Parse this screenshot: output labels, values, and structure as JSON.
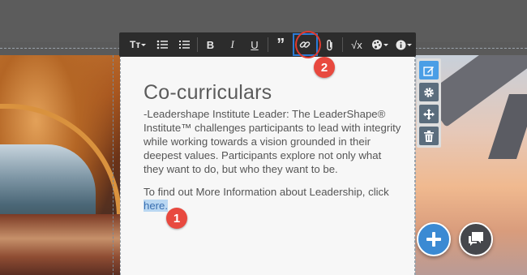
{
  "toolbar": {
    "items": [
      {
        "name": "text-style",
        "label": "Tт"
      },
      {
        "name": "bullet-list"
      },
      {
        "name": "numbered-list"
      },
      {
        "name": "bold",
        "label": "B"
      },
      {
        "name": "italic",
        "label": "I"
      },
      {
        "name": "underline",
        "label": "U"
      },
      {
        "name": "quote",
        "label": "”"
      },
      {
        "name": "link"
      },
      {
        "name": "attachment"
      },
      {
        "name": "equation",
        "label": "√x"
      },
      {
        "name": "color"
      },
      {
        "name": "info"
      }
    ]
  },
  "content": {
    "title": "Co-curriculars",
    "paragraph1": "-Leadershape Institute Leader: The LeaderShape® Institute™  challenges participants to lead with integrity while working towards a vision grounded in their deepest values. Participants explore not only what they want to do, but who they want to be.",
    "paragraph2_text": "To find out More Information about Leadership, click ",
    "link_text": "here."
  },
  "callouts": {
    "one": "1",
    "two": "2"
  },
  "side_tools": [
    "edit-icon",
    "gear-icon",
    "move-icon",
    "trash-icon"
  ],
  "fabs": [
    "add-icon",
    "chat-icon"
  ],
  "colors": {
    "accent": "#2b7bd6",
    "callout": "#e8493f",
    "toolbar": "#2c2c2c"
  }
}
